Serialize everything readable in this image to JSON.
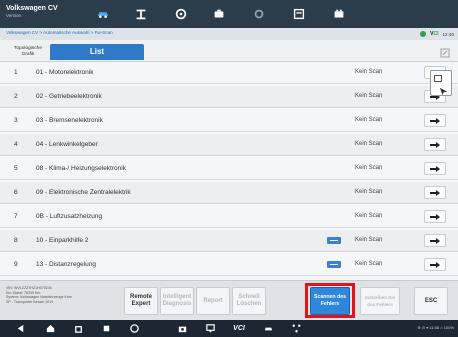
{
  "header": {
    "title": "Volkswagen CV",
    "subtitle": "Version",
    "icons": [
      "car-icon",
      "lift-icon",
      "steering-icon",
      "engine-icon",
      "settings-icon",
      "report-icon",
      "battery-icon"
    ]
  },
  "breadcrumb": "Volkswagen CV > Automatische Auswahl > Fw-Scan",
  "status": {
    "vci_prefix": "V",
    "vci_highlight": "CI",
    "time": "12:40"
  },
  "tabs": {
    "topology": "Topologische Grafik",
    "list": "List"
  },
  "rows": [
    {
      "num": "1",
      "name": "01 - Motorelektronik",
      "state": "Kein Scan",
      "badge": false
    },
    {
      "num": "2",
      "name": "02 - Getriebeelektronik",
      "state": "Kein Scan",
      "badge": false
    },
    {
      "num": "3",
      "name": "03 - Bremsenelektronik",
      "state": "Kein Scan",
      "badge": false
    },
    {
      "num": "4",
      "name": "04 - Lenkwinkelgeber",
      "state": "Kein Scan",
      "badge": false
    },
    {
      "num": "5",
      "name": "08 - Klima-/ Heizungselektronik",
      "state": "Kein Scan",
      "badge": false
    },
    {
      "num": "6",
      "name": "09 - Elektronische Zentralelektrik",
      "state": "Kein Scan",
      "badge": false
    },
    {
      "num": "7",
      "name": "0B - Luftzusatzheizung",
      "state": "Kein Scan",
      "badge": false
    },
    {
      "num": "8",
      "name": "10 - Einparkhilfe 2",
      "state": "Kein Scan",
      "badge": true
    },
    {
      "num": "9",
      "name": "13 - Distanzregelung",
      "state": "Kein Scan",
      "badge": true
    }
  ],
  "vehicle_info": [
    "VIN: WV1ZZZ7HZ1H075245",
    "Km-Stand: 78339 Km",
    "System: Volkswagen Nutzfahrzeuge Kom",
    "SP - Transporter Benzin 2019"
  ],
  "actions": {
    "remote": "Remote Expert",
    "intelligent": "Intelligent Diagnosis",
    "report": "Report",
    "quickclear": "Schnell Löschen",
    "scan": "Scannen des Fehlers",
    "select": "Schreiben Sie das Fehlers",
    "esc": "ESC"
  },
  "navbar": {
    "vci": "VCI",
    "status": "⊕ ⊙ ▾ 11:58 ⌂ 100%"
  },
  "colors": {
    "accent": "#2f79c9",
    "highlight": "#e1141a",
    "header": "#2b3d4a"
  }
}
